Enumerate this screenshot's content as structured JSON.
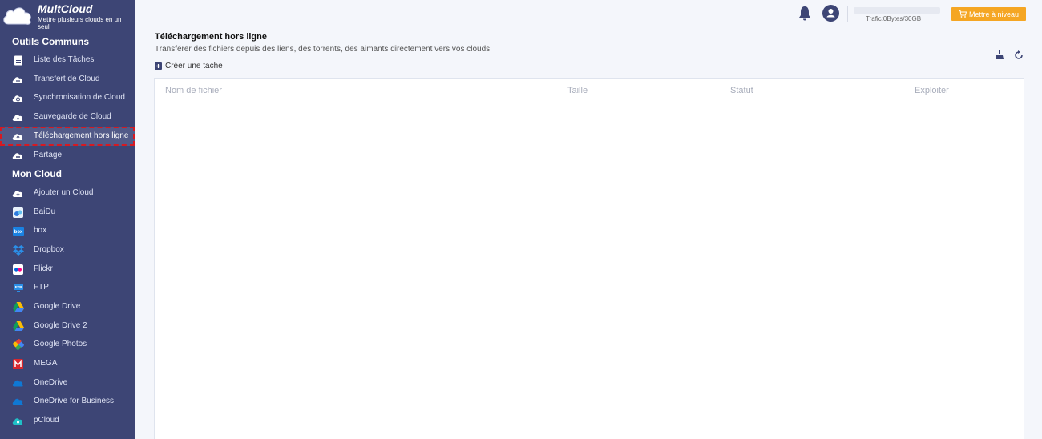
{
  "brand": {
    "name": "MultCloud",
    "tagline": "Mettre plusieurs clouds en un seul"
  },
  "sections": {
    "tools": "Outils Communs",
    "clouds": "Mon Cloud"
  },
  "tools_items": [
    {
      "label": "Liste des Tâches",
      "icon": "task-list-icon"
    },
    {
      "label": "Transfert de Cloud",
      "icon": "cloud-transfer-icon"
    },
    {
      "label": "Synchronisation de Cloud",
      "icon": "cloud-sync-icon"
    },
    {
      "label": "Sauvegarde de Cloud",
      "icon": "cloud-backup-icon"
    },
    {
      "label": "Téléchargement hors ligne",
      "icon": "cloud-upload-icon",
      "active": true
    },
    {
      "label": "Partage",
      "icon": "cloud-share-icon"
    }
  ],
  "cloud_items": [
    {
      "label": "Ajouter un Cloud",
      "icon": "add-cloud-icon"
    },
    {
      "label": "BaiDu",
      "icon": "baidu-icon"
    },
    {
      "label": "box",
      "icon": "box-icon"
    },
    {
      "label": "Dropbox",
      "icon": "dropbox-icon"
    },
    {
      "label": "Flickr",
      "icon": "flickr-icon"
    },
    {
      "label": "FTP",
      "icon": "ftp-icon"
    },
    {
      "label": "Google Drive",
      "icon": "google-drive-icon"
    },
    {
      "label": "Google Drive 2",
      "icon": "google-drive-icon"
    },
    {
      "label": "Google Photos",
      "icon": "google-photos-icon"
    },
    {
      "label": "MEGA",
      "icon": "mega-icon"
    },
    {
      "label": "OneDrive",
      "icon": "onedrive-icon"
    },
    {
      "label": "OneDrive for Business",
      "icon": "onedrive-icon"
    },
    {
      "label": "pCloud",
      "icon": "pcloud-icon"
    }
  ],
  "header": {
    "traffic": "Trafic:0Bytes/30GB",
    "traffic_used_fraction": 0,
    "upgrade_label": "Mettre à niveau"
  },
  "main": {
    "title": "Téléchargement hors ligne",
    "subtitle": "Transférer des fichiers depuis des liens, des torrents, des aimants directement vers vos clouds",
    "create_task": "Créer une tache",
    "columns": [
      "Nom de fichier",
      "Taille",
      "Statut",
      "Exploiter"
    ]
  },
  "colors": {
    "sidebar": "#3d4575",
    "accent": "#f5a623",
    "highlight_border": "#d71921"
  }
}
